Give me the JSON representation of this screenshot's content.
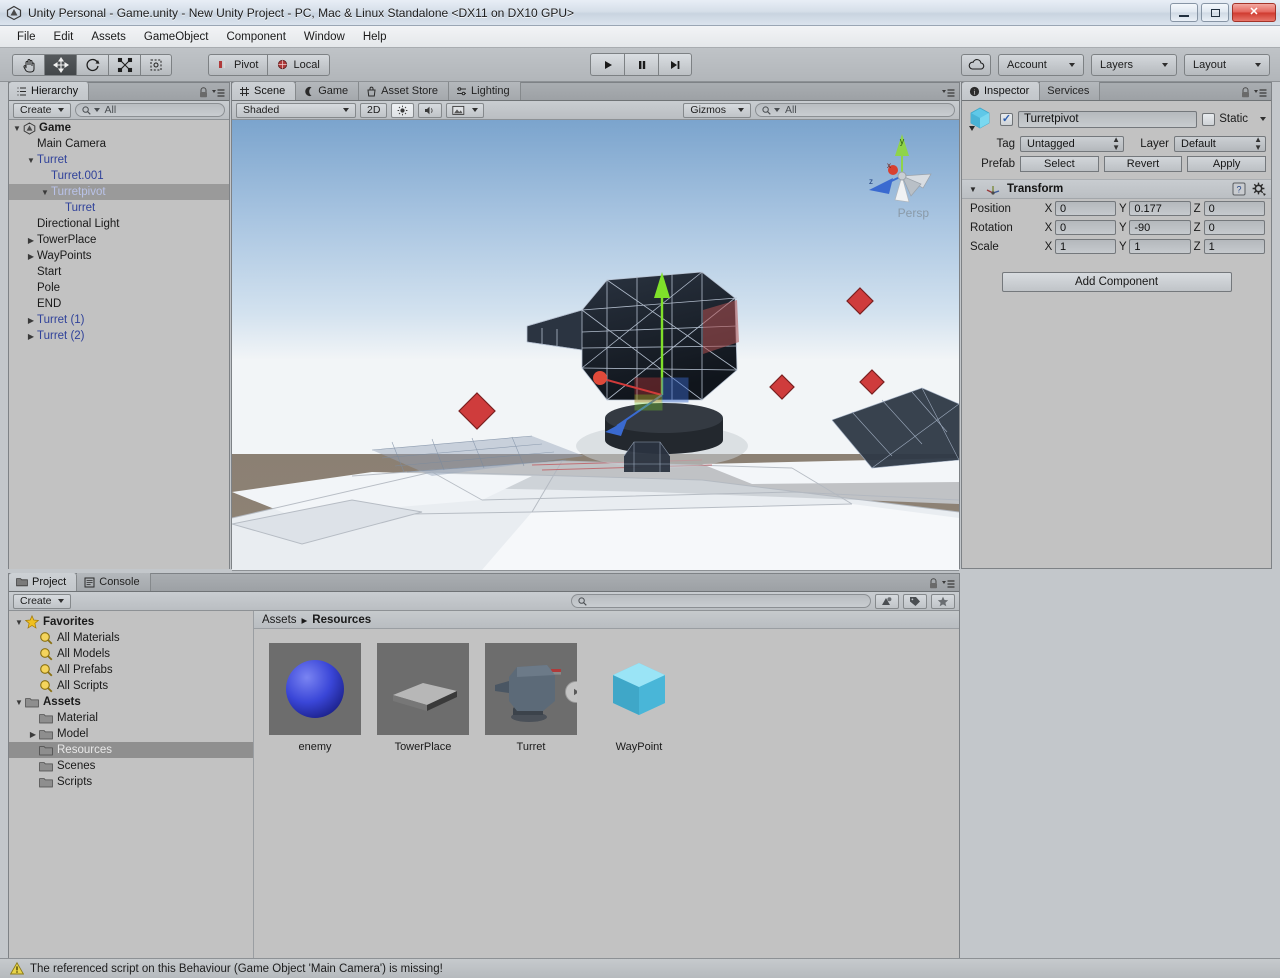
{
  "window": {
    "title": "Unity Personal - Game.unity - New Unity Project - PC, Mac & Linux Standalone <DX11 on DX10 GPU>",
    "icon": "unity-logo-icon",
    "minimize_label": "–",
    "maximize_label": "□",
    "close_label": "✕"
  },
  "menubar": {
    "items": [
      {
        "label": "File"
      },
      {
        "label": "Edit"
      },
      {
        "label": "Assets"
      },
      {
        "label": "GameObject"
      },
      {
        "label": "Component"
      },
      {
        "label": "Window"
      },
      {
        "label": "Help"
      }
    ]
  },
  "toolbar": {
    "tools": [
      {
        "name": "hand-tool",
        "active": false
      },
      {
        "name": "move-tool",
        "active": true
      },
      {
        "name": "rotate-tool",
        "active": false
      },
      {
        "name": "scale-tool",
        "active": false
      },
      {
        "name": "rect-tool",
        "active": false
      }
    ],
    "pivot_label": "Pivot",
    "local_label": "Local",
    "play_label": "Play",
    "pause_label": "Pause",
    "step_label": "Step",
    "cloud_label": "Collab",
    "account_label": "Account",
    "layers_label": "Layers",
    "layout_label": "Layout"
  },
  "hierarchy": {
    "tab_label": "Hierarchy",
    "create_label": "Create",
    "search_placeholder": "All",
    "items": [
      {
        "label": "Game",
        "depth": 0,
        "arrow": "open",
        "prefab": false,
        "selected": false,
        "root": true
      },
      {
        "label": "Main Camera",
        "depth": 1,
        "arrow": "none",
        "prefab": false,
        "selected": false,
        "root": false
      },
      {
        "label": "Turret",
        "depth": 1,
        "arrow": "open",
        "prefab": true,
        "selected": false,
        "root": false
      },
      {
        "label": "Turret.001",
        "depth": 2,
        "arrow": "none",
        "prefab": true,
        "selected": false,
        "root": false
      },
      {
        "label": "Turretpivot",
        "depth": 2,
        "arrow": "open",
        "prefab": true,
        "selected": true,
        "root": false
      },
      {
        "label": "Turret",
        "depth": 3,
        "arrow": "none",
        "prefab": true,
        "selected": false,
        "root": false
      },
      {
        "label": "Directional Light",
        "depth": 1,
        "arrow": "none",
        "prefab": false,
        "selected": false,
        "root": false
      },
      {
        "label": "TowerPlace",
        "depth": 1,
        "arrow": "closed",
        "prefab": false,
        "selected": false,
        "root": false
      },
      {
        "label": "WayPoints",
        "depth": 1,
        "arrow": "closed",
        "prefab": false,
        "selected": false,
        "root": false
      },
      {
        "label": "Start",
        "depth": 1,
        "arrow": "none",
        "prefab": false,
        "selected": false,
        "root": false
      },
      {
        "label": "Pole",
        "depth": 1,
        "arrow": "none",
        "prefab": false,
        "selected": false,
        "root": false
      },
      {
        "label": "END",
        "depth": 1,
        "arrow": "none",
        "prefab": false,
        "selected": false,
        "root": false
      },
      {
        "label": "Turret (1)",
        "depth": 1,
        "arrow": "closed",
        "prefab": true,
        "selected": false,
        "root": false
      },
      {
        "label": "Turret (2)",
        "depth": 1,
        "arrow": "closed",
        "prefab": true,
        "selected": false,
        "root": false
      }
    ]
  },
  "scene": {
    "tabs": [
      {
        "label": "Scene",
        "icon": "grid-icon",
        "selected": true
      },
      {
        "label": "Game",
        "icon": "game-icon",
        "selected": false
      },
      {
        "label": "Asset Store",
        "icon": "store-icon",
        "selected": false
      },
      {
        "label": "Lighting",
        "icon": "light-icon",
        "selected": false
      }
    ],
    "shading_label": "Shaded",
    "mode_2d_label": "2D",
    "gizmos_label": "Gizmos",
    "search_placeholder": "All",
    "perspective_label": "Persp",
    "gizmo_axes": {
      "x": "x",
      "y": "y",
      "z": "z"
    }
  },
  "inspector": {
    "tabs": [
      {
        "label": "Inspector",
        "selected": true
      },
      {
        "label": "Services",
        "selected": false
      }
    ],
    "object_name": "Turretpivot",
    "enabled": true,
    "static_label": "Static",
    "tag_label": "Tag",
    "tag_value": "Untagged",
    "layer_label": "Layer",
    "layer_value": "Default",
    "prefab_label": "Prefab",
    "prefab_buttons": [
      {
        "label": "Select"
      },
      {
        "label": "Revert"
      },
      {
        "label": "Apply"
      }
    ],
    "transform": {
      "title": "Transform",
      "rows": [
        {
          "label": "Position",
          "x": "0",
          "y": "0.177",
          "z": "0"
        },
        {
          "label": "Rotation",
          "x": "0",
          "y": "-90",
          "z": "0"
        },
        {
          "label": "Scale",
          "x": "1",
          "y": "1",
          "z": "1"
        }
      ],
      "axis_x": "X",
      "axis_y": "Y",
      "axis_z": "Z"
    },
    "add_component_label": "Add Component"
  },
  "project": {
    "tabs": [
      {
        "label": "Project",
        "selected": true
      },
      {
        "label": "Console",
        "selected": false
      }
    ],
    "create_label": "Create",
    "search_placeholder": "",
    "tree": [
      {
        "label": "Favorites",
        "depth": 0,
        "icon": "star-icon",
        "arrow": "open",
        "bold": true,
        "selected": false
      },
      {
        "label": "All Materials",
        "depth": 1,
        "icon": "search-icon",
        "arrow": "none",
        "bold": false,
        "selected": false
      },
      {
        "label": "All Models",
        "depth": 1,
        "icon": "search-icon",
        "arrow": "none",
        "bold": false,
        "selected": false
      },
      {
        "label": "All Prefabs",
        "depth": 1,
        "icon": "search-icon",
        "arrow": "none",
        "bold": false,
        "selected": false
      },
      {
        "label": "All Scripts",
        "depth": 1,
        "icon": "search-icon",
        "arrow": "none",
        "bold": false,
        "selected": false
      },
      {
        "label": "Assets",
        "depth": 0,
        "icon": "folder-icon",
        "arrow": "open",
        "bold": true,
        "selected": false
      },
      {
        "label": "Material",
        "depth": 1,
        "icon": "folder-icon",
        "arrow": "none",
        "bold": false,
        "selected": false
      },
      {
        "label": "Model",
        "depth": 1,
        "icon": "folder-icon",
        "arrow": "closed",
        "bold": false,
        "selected": false
      },
      {
        "label": "Resources",
        "depth": 1,
        "icon": "folder-icon",
        "arrow": "none",
        "bold": false,
        "selected": true
      },
      {
        "label": "Scenes",
        "depth": 1,
        "icon": "folder-icon",
        "arrow": "none",
        "bold": false,
        "selected": false
      },
      {
        "label": "Scripts",
        "depth": 1,
        "icon": "folder-icon",
        "arrow": "none",
        "bold": false,
        "selected": false
      }
    ],
    "breadcrumb": {
      "root": "Assets",
      "separator": "▸",
      "current": "Resources"
    },
    "assets": [
      {
        "label": "enemy",
        "thumb": "blue-sphere",
        "has_play_overlay": false
      },
      {
        "label": "TowerPlace",
        "thumb": "gray-plane",
        "has_play_overlay": false
      },
      {
        "label": "Turret",
        "thumb": "turret-model",
        "has_play_overlay": true
      },
      {
        "label": "WayPoint",
        "thumb": "cyan-cube",
        "has_play_overlay": false
      }
    ]
  },
  "statusbar": {
    "icon": "warning-icon",
    "message": "The referenced script on this Behaviour (Game Object 'Main Camera') is missing!"
  },
  "colors": {
    "prefab_blue": "#30429a",
    "selection_gray": "#9a9a9a",
    "warning_yellow": "#e8d44a",
    "accent_cyan": "#5fc8e8",
    "enemy_blue": "#3a46d8"
  }
}
